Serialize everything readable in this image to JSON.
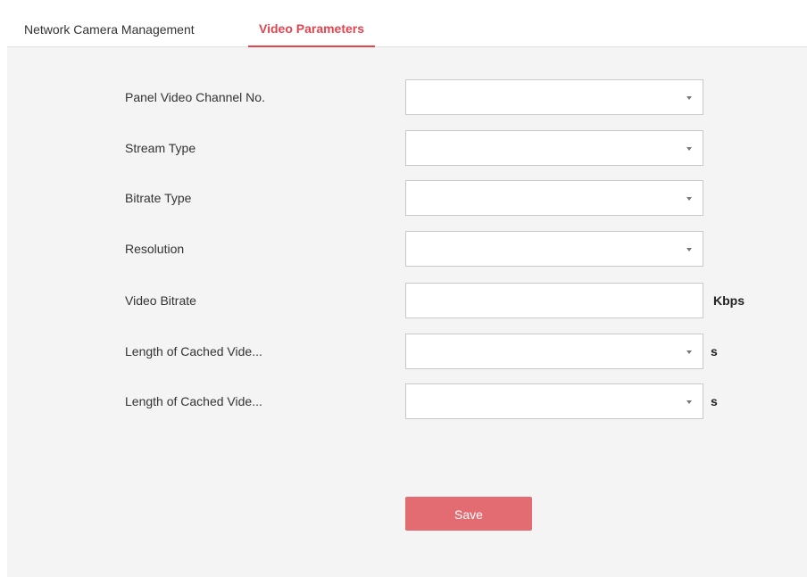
{
  "tabs": [
    {
      "label": "Network Camera Management",
      "active": false
    },
    {
      "label": "Video Parameters",
      "active": true
    }
  ],
  "form": {
    "rows": [
      {
        "label": "Panel Video Channel No.",
        "type": "select",
        "value": "",
        "unit": ""
      },
      {
        "label": "Stream Type",
        "type": "select",
        "value": "",
        "unit": ""
      },
      {
        "label": "Bitrate Type",
        "type": "select",
        "value": "",
        "unit": ""
      },
      {
        "label": "Resolution",
        "type": "select",
        "value": "",
        "unit": ""
      },
      {
        "label": "Video Bitrate",
        "type": "text",
        "value": "",
        "unit": "Kbps"
      },
      {
        "label": "Length of Cached Vide...",
        "type": "select",
        "value": "",
        "unit": "s"
      },
      {
        "label": "Length of Cached Vide...",
        "type": "select",
        "value": "",
        "unit": "s"
      }
    ],
    "save_label": "Save"
  },
  "colors": {
    "accent": "#e2454f",
    "save_button": "#e36b72",
    "panel_background": "#f4f4f4",
    "field_border": "#c9c9c9"
  },
  "icons": {
    "dropdown": "caret-down-icon"
  }
}
